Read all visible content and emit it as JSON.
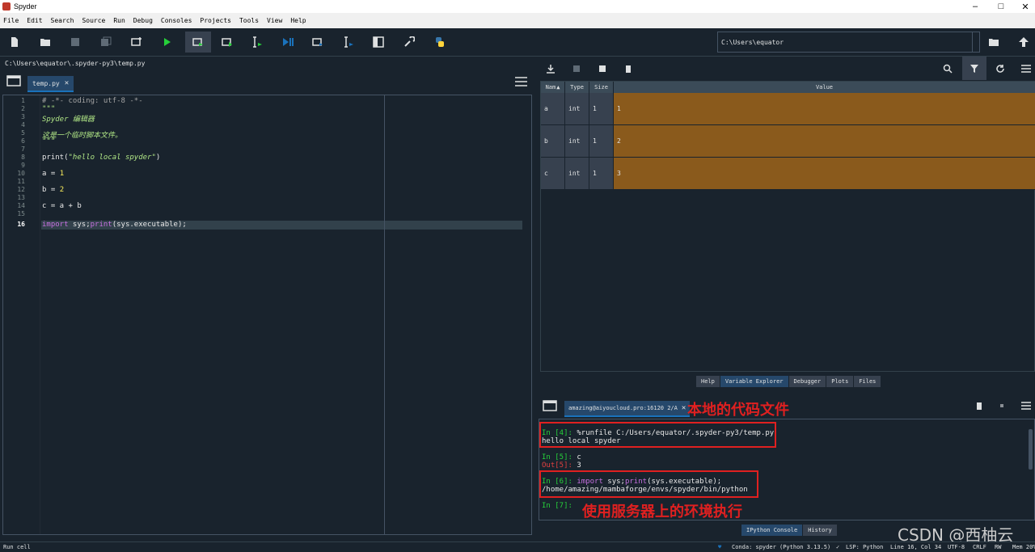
{
  "window": {
    "title": "Spyder"
  },
  "menu": [
    "File",
    "Edit",
    "Search",
    "Source",
    "Run",
    "Debug",
    "Consoles",
    "Projects",
    "Tools",
    "View",
    "Help"
  ],
  "toolbar": {
    "working_dir": "C:\\Users\\equator"
  },
  "editor": {
    "file_path": "C:\\Users\\equator\\.spyder-py3\\temp.py",
    "tab_label": "temp.py",
    "line_numbers": [
      "1",
      "2",
      "3",
      "4",
      "5",
      "6",
      "7",
      "8",
      "9",
      "10",
      "11",
      "12",
      "13",
      "14",
      "15",
      "16"
    ],
    "current_line": "16",
    "code": {
      "l1": "# -*- coding: utf-8 -*-",
      "l2": "\"\"\"",
      "l3": "Spyder 编辑器",
      "l5": "这是一个临时脚本文件。",
      "l6": "\"\"\"",
      "l8_fn": "print",
      "l8_str": "\"hello local spyder\"",
      "l10_a": "a = ",
      "l10_v": "1",
      "l12_a": "b = ",
      "l12_v": "2",
      "l14": "c = a + b",
      "l16_kw": "import",
      "l16_a": " sys;",
      "l16_fn": "print",
      "l16_b": "(sys.executable);"
    }
  },
  "variable_explorer": {
    "columns": {
      "name": "Nam",
      "type": "Type",
      "size": "Size",
      "value": "Value"
    },
    "rows": [
      {
        "name": "a",
        "type": "int",
        "size": "1",
        "value": "1"
      },
      {
        "name": "b",
        "type": "int",
        "size": "1",
        "value": "2"
      },
      {
        "name": "c",
        "type": "int",
        "size": "1",
        "value": "3"
      }
    ],
    "tabs": [
      "Help",
      "Variable Explorer",
      "Debugger",
      "Plots",
      "Files"
    ]
  },
  "console": {
    "tab_label": "amazing@aiyoucloud.pro:16120 2/A",
    "lines": {
      "in4_prompt": "In [4]: ",
      "in4_cmd": "%runfile C:/Users/equator/.spyder-py3/temp.py",
      "out_hello": "hello local spyder",
      "in5_prompt": "In [5]: ",
      "in5_cmd": "c",
      "out5_prompt": "Out[5]: ",
      "out5_val": "3",
      "in6_prompt": "In [6]: ",
      "in6_kw": "import",
      "in6_a": " sys;",
      "in6_fn": "print",
      "in6_b": "(sys.executable);",
      "out_exe": "/home/amazing/mambaforge/envs/spyder/bin/python",
      "in7_prompt": "In [7]: "
    },
    "tabs": [
      "IPython Console",
      "History"
    ]
  },
  "annotations": {
    "local_file": "本地的代码文件",
    "server_env": "使用服务器上的环境执行"
  },
  "statusbar": {
    "left": "Run cell",
    "conda": "Conda: spyder (Python 3.13.5)",
    "lsp": "LSP: Python",
    "position": "Line 16, Col 34",
    "encoding": "UTF-8",
    "eol": "CRLF",
    "rw": "RW",
    "mem": "Mem 20%"
  },
  "watermark": "CSDN @西柚云",
  "colors": {
    "accent": "#26486b",
    "value_cell": "#8a5a1c",
    "annotation": "#e02020"
  }
}
